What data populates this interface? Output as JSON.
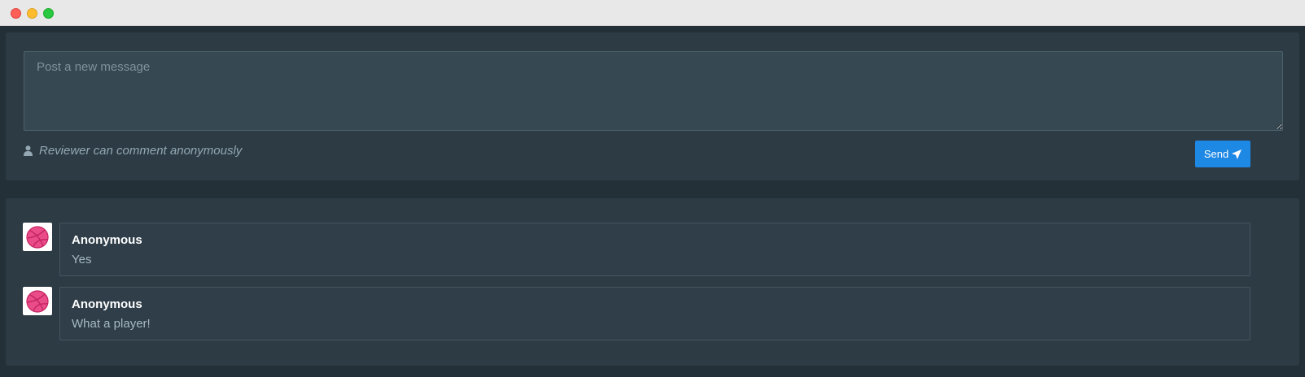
{
  "composer": {
    "placeholder": "Post a new message",
    "value": "",
    "anonymous_note": "Reviewer can comment anonymously",
    "send_label": "Send",
    "user_icon": "user-icon",
    "send_icon": "paper-plane-icon"
  },
  "comments": [
    {
      "author": "Anonymous",
      "text": "Yes",
      "avatar_icon": "dribbble-icon"
    },
    {
      "author": "Anonymous",
      "text": "What a player!",
      "avatar_icon": "dribbble-icon"
    }
  ],
  "colors": {
    "accent": "#1e88e5",
    "avatar": "#ea4c89"
  }
}
